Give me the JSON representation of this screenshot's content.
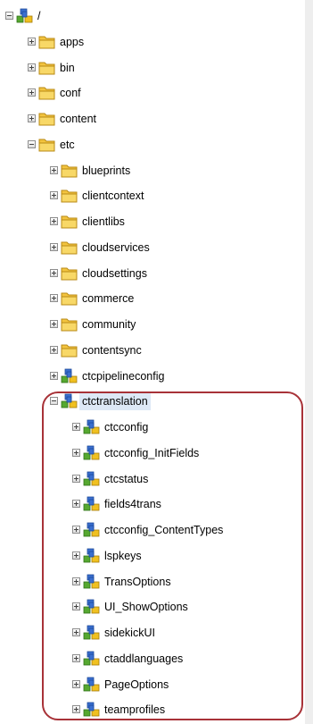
{
  "tree": {
    "root": {
      "label": "/",
      "icon": "node-icon",
      "expanded": true
    },
    "top_level": [
      {
        "label": "apps",
        "icon": "folder-icon",
        "expanded": false
      },
      {
        "label": "bin",
        "icon": "folder-icon",
        "expanded": false
      },
      {
        "label": "conf",
        "icon": "folder-icon",
        "expanded": false
      },
      {
        "label": "content",
        "icon": "folder-icon",
        "expanded": false
      },
      {
        "label": "etc",
        "icon": "folder-icon",
        "expanded": true
      }
    ],
    "etc_children": [
      {
        "label": "blueprints",
        "icon": "folder-icon",
        "expanded": false
      },
      {
        "label": "clientcontext",
        "icon": "folder-icon",
        "expanded": false
      },
      {
        "label": "clientlibs",
        "icon": "folder-icon",
        "expanded": false
      },
      {
        "label": "cloudservices",
        "icon": "folder-icon",
        "expanded": false
      },
      {
        "label": "cloudsettings",
        "icon": "folder-icon",
        "expanded": false
      },
      {
        "label": "commerce",
        "icon": "folder-icon",
        "expanded": false
      },
      {
        "label": "community",
        "icon": "folder-icon",
        "expanded": false
      },
      {
        "label": "contentsync",
        "icon": "folder-icon",
        "expanded": false
      },
      {
        "label": "ctcpipelineconfig",
        "icon": "node-icon",
        "expanded": false
      },
      {
        "label": "ctctranslation",
        "icon": "node-icon",
        "expanded": true,
        "selected": true
      }
    ],
    "ctctranslation_children": [
      {
        "label": "ctcconfig",
        "icon": "node-icon",
        "expanded": false
      },
      {
        "label": "ctcconfig_InitFields",
        "icon": "node-icon",
        "expanded": false
      },
      {
        "label": "ctcstatus",
        "icon": "node-icon",
        "expanded": false
      },
      {
        "label": "fields4trans",
        "icon": "node-icon",
        "expanded": false
      },
      {
        "label": "ctcconfig_ContentTypes",
        "icon": "node-icon",
        "expanded": false
      },
      {
        "label": "lspkeys",
        "icon": "node-icon",
        "expanded": false
      },
      {
        "label": "TransOptions",
        "icon": "node-icon",
        "expanded": false
      },
      {
        "label": "UI_ShowOptions",
        "icon": "node-icon",
        "expanded": false
      },
      {
        "label": "sidekickUI",
        "icon": "node-icon",
        "expanded": false
      },
      {
        "label": "ctaddlanguages",
        "icon": "node-icon",
        "expanded": false
      },
      {
        "label": "PageOptions",
        "icon": "node-icon",
        "expanded": false
      },
      {
        "label": "teamprofiles",
        "icon": "node-icon",
        "expanded": false
      }
    ]
  },
  "colors": {
    "selection": "#dde8f6",
    "highlight_ring": "#a83238",
    "folder": "#f3c43f",
    "node_blue": "#3a6fd0",
    "node_green": "#56a830",
    "node_yellow": "#f0c020"
  }
}
